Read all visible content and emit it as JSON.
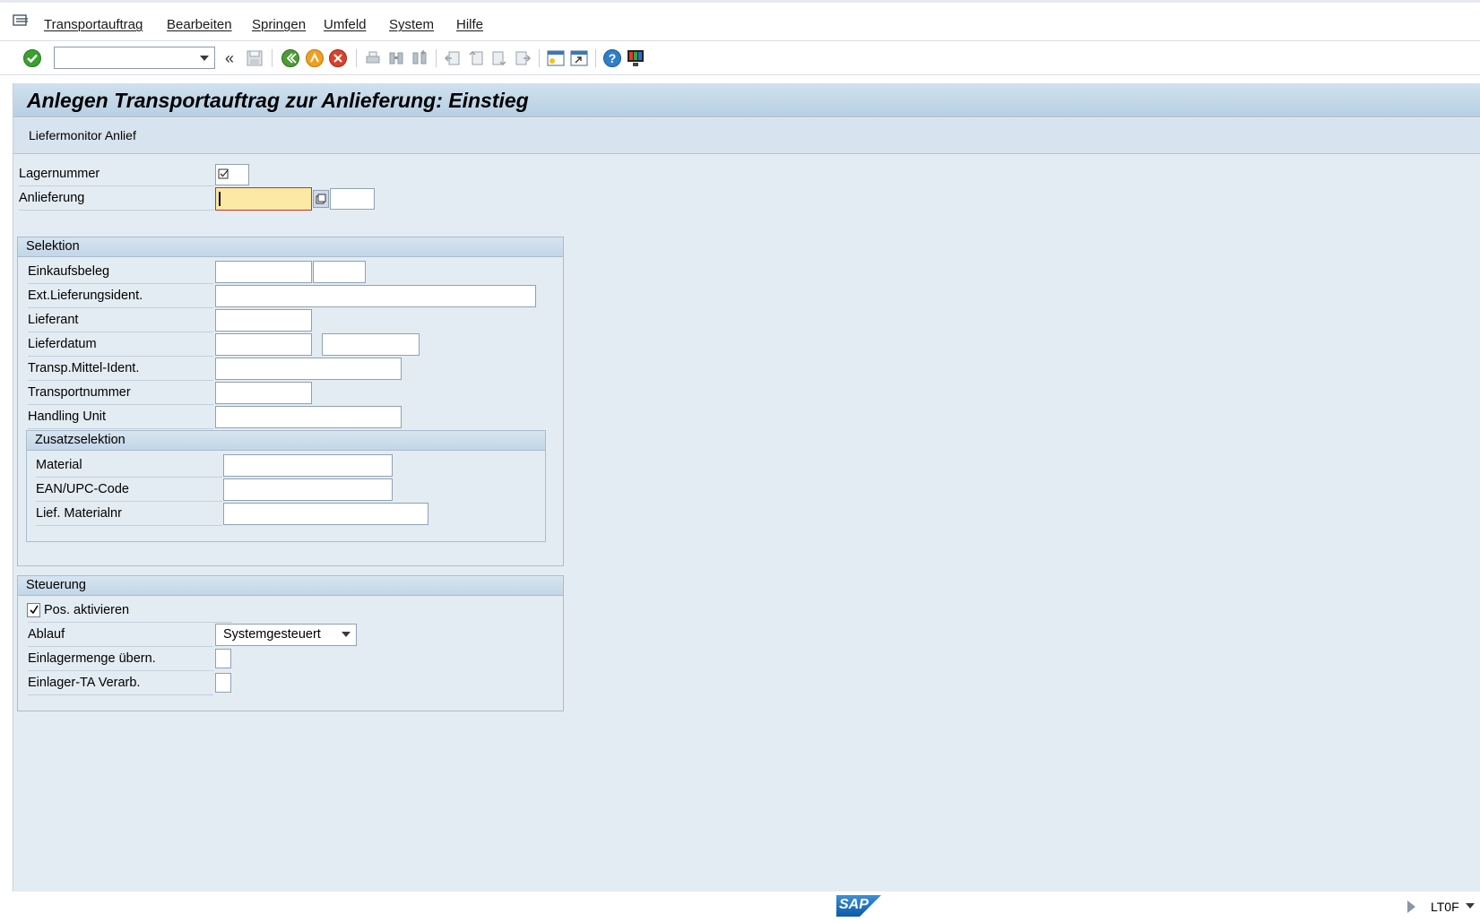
{
  "menu": {
    "items": [
      "Transportauftrag",
      "Bearbeiten",
      "Springen",
      "Umfeld",
      "System",
      "Hilfe"
    ]
  },
  "toolbar": {
    "command_field_value": "",
    "icons": [
      "enter-icon",
      "back-icon",
      "exit-icon",
      "cancel-icon",
      "print-icon",
      "find-icon",
      "find-next-icon",
      "first-page-icon",
      "previous-page-icon",
      "next-page-icon",
      "last-page-icon",
      "new-session-icon",
      "shortcut-icon",
      "help-icon",
      "layout-icon"
    ]
  },
  "title": "Anlegen Transportauftrag zur Anlieferung: Einstieg",
  "app_toolbar": {
    "button": "Liefermonitor Anlief"
  },
  "header_fields": {
    "lagernummer": {
      "label": "Lagernummer",
      "value": ""
    },
    "anlieferung": {
      "label": "Anlieferung",
      "value": "",
      "value2": ""
    }
  },
  "selektion": {
    "title": "Selektion",
    "fields": {
      "einkaufsbeleg": "Einkaufsbeleg",
      "ext_lieferungsident": "Ext.Lieferungsident.",
      "lieferant": "Lieferant",
      "lieferdatum": "Lieferdatum",
      "transp_mittel": "Transp.Mittel-Ident.",
      "transportnummer": "Transportnummer",
      "handling_unit": "Handling Unit"
    },
    "zusatz": {
      "title": "Zusatzselektion",
      "fields": {
        "material": "Material",
        "ean": "EAN/UPC-Code",
        "lief_materialnr": "Lief. Materialnr"
      }
    }
  },
  "steuerung": {
    "title": "Steuerung",
    "pos_aktivieren": {
      "label": "Pos. aktivieren",
      "checked": true
    },
    "ablauf": {
      "label": "Ablauf",
      "value": "Systemgesteuert"
    },
    "einlagermenge": {
      "label": "Einlagermenge übern.",
      "checked": false
    },
    "einlager_ta": {
      "label": "Einlager-TA Verarb.",
      "checked": false
    }
  },
  "status_bar": {
    "logo": "SAP",
    "transaction": "LT0F"
  },
  "colors": {
    "title_gradient_top": "#d0e1ef",
    "background": "#e4ecf3",
    "focus_field": "#fde9a6",
    "accent_red": "#d9281e"
  }
}
